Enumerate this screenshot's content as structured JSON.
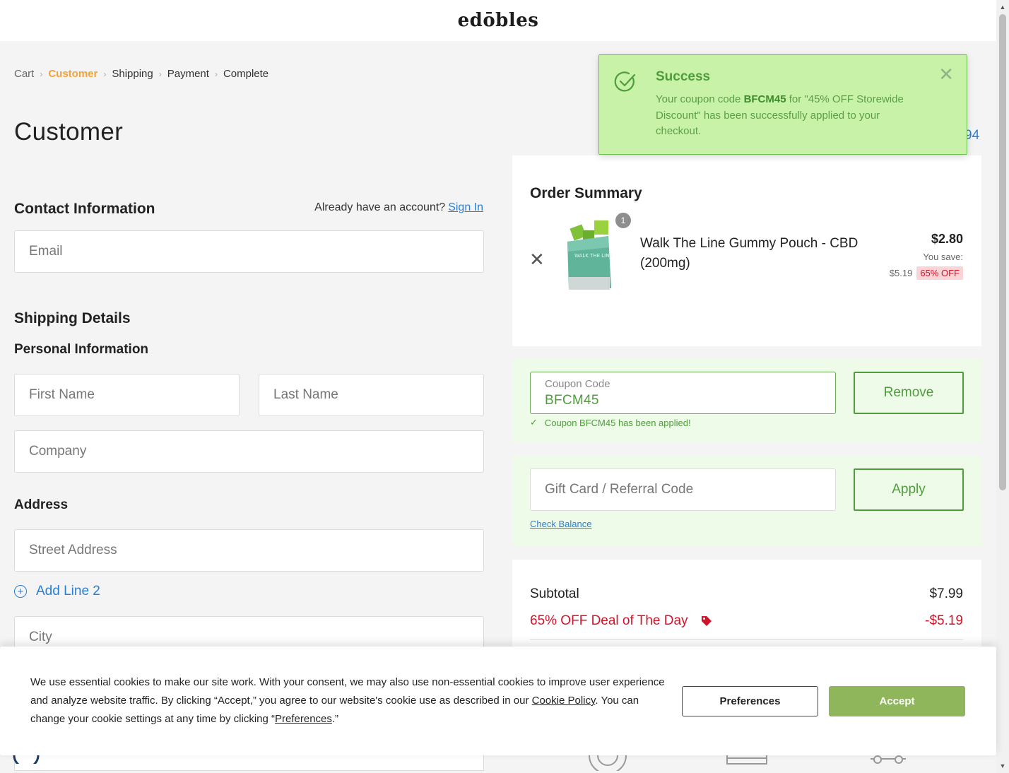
{
  "brand": {
    "logo_text": "edōbles"
  },
  "breadcrumb": {
    "items": [
      {
        "label": "Cart",
        "state": "done"
      },
      {
        "label": "Customer",
        "state": "active"
      },
      {
        "label": "Shipping",
        "state": "upcoming"
      },
      {
        "label": "Payment",
        "state": "upcoming"
      },
      {
        "label": "Complete",
        "state": "upcoming"
      }
    ]
  },
  "page": {
    "title": "Customer"
  },
  "contact": {
    "heading": "Contact Information",
    "account_prompt": "Already have an account?",
    "sign_in_label": "Sign In",
    "email_placeholder": "Email"
  },
  "shipping": {
    "heading": "Shipping Details",
    "personal_heading": "Personal Information",
    "first_name_placeholder": "First Name",
    "last_name_placeholder": "Last Name",
    "company_placeholder": "Company",
    "address_heading": "Address",
    "street_placeholder": "Street Address",
    "add_line_label": "Add Line 2",
    "city_placeholder": "City"
  },
  "toast": {
    "title": "Success",
    "message_prefix": "Your coupon code ",
    "coupon_code": "BFCM45",
    "message_suffix": " for \"45% OFF Storewide Discount\" has been successfully applied to your checkout.",
    "peek_text": "94"
  },
  "order_summary": {
    "title": "Order Summary",
    "item": {
      "name": "Walk The Line Gummy Pouch - CBD (200mg)",
      "quantity": "1",
      "price": "$2.80",
      "you_save_label": "You save:",
      "saved_amount": "$5.19",
      "discount_badge": "65% OFF",
      "package_text": "WALK THE LINE"
    }
  },
  "coupon": {
    "label": "Coupon Code",
    "value": "BFCM45",
    "remove_label": "Remove",
    "applied_message": "Coupon BFCM45 has been applied!"
  },
  "gift_card": {
    "placeholder": "Gift Card / Referral Code",
    "apply_label": "Apply",
    "check_balance_label": "Check Balance"
  },
  "totals": {
    "subtotal_label": "Subtotal",
    "subtotal_value": "$7.99",
    "discount_label": "65% OFF Deal of The Day",
    "discount_value": "-$5.19"
  },
  "cookie_banner": {
    "text_part1": "We use essential cookies to make our site work. With your consent, we may also use non-essential cookies to improve user experience and analyze website traffic. By clicking “Accept,” you agree to our website's cookie use as described in our ",
    "cookie_policy_link": "Cookie Policy",
    "text_part2": ". You can change your cookie settings at any time by clicking “",
    "preferences_link": "Preferences",
    "text_part3": ".”",
    "preferences_button": "Preferences",
    "accept_button": "Accept"
  },
  "colors": {
    "brand_green": "#4e9c3c",
    "accent_orange": "#f0a33a",
    "link_blue": "#2a7fd4",
    "discount_red": "#d0142a",
    "toast_bg": "#c9f2a9",
    "accept_green": "#8fb65a"
  },
  "icons": {
    "toast": "check-circle-icon",
    "close": "close-icon",
    "remove_item": "close-icon",
    "add_line": "plus-circle-icon",
    "applied": "checkmark-icon",
    "discount": "tag-icon"
  }
}
